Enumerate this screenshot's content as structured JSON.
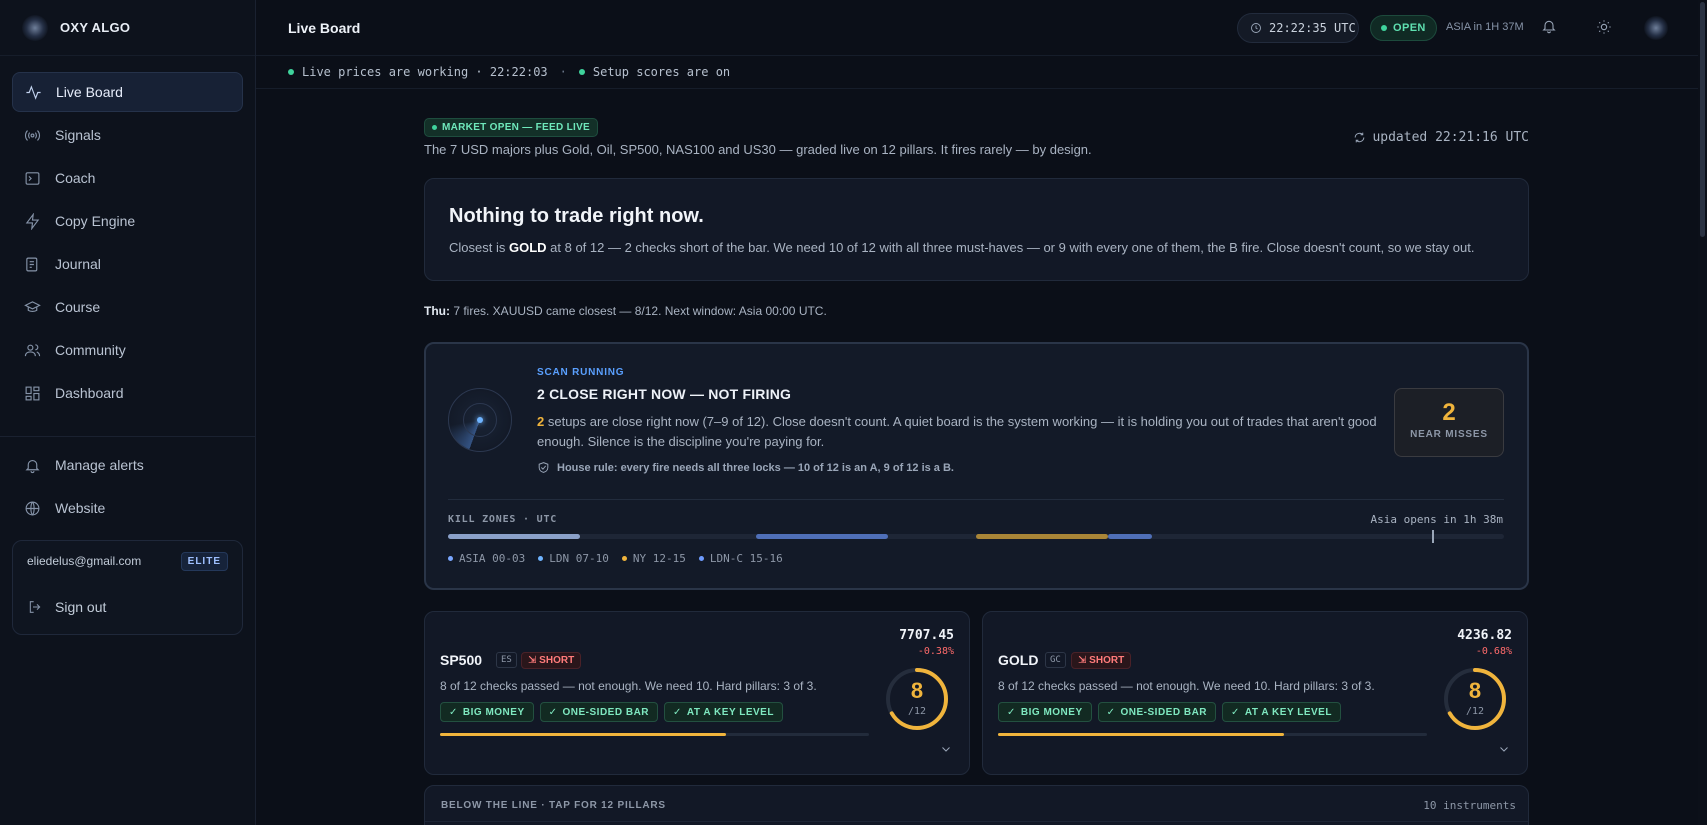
{
  "app": {
    "name": "OXY ALGO"
  },
  "sidebar": {
    "items": [
      {
        "label": "Live Board",
        "icon": "activity-icon"
      },
      {
        "label": "Signals",
        "icon": "broadcast-icon"
      },
      {
        "label": "Coach",
        "icon": "terminal-icon"
      },
      {
        "label": "Copy Engine",
        "icon": "lightning-icon"
      },
      {
        "label": "Journal",
        "icon": "journal-icon"
      },
      {
        "label": "Course",
        "icon": "graduation-cap-icon"
      },
      {
        "label": "Community",
        "icon": "users-icon"
      },
      {
        "label": "Dashboard",
        "icon": "grid-icon"
      }
    ],
    "secondary": [
      {
        "label": "Manage alerts",
        "icon": "bell-icon"
      },
      {
        "label": "Website",
        "icon": "globe-icon"
      }
    ],
    "user": {
      "email": "eliedelus@gmail.com",
      "tier": "ELITE",
      "signout": "Sign out"
    }
  },
  "header": {
    "title": "Live Board",
    "clock": "22:22:35 UTC",
    "market_status": "OPEN",
    "session_countdown": "ASIA in 1H 37M"
  },
  "status": {
    "prices": "Live prices are working · 22:22:03",
    "separator": "·",
    "scores": "Setup scores are on"
  },
  "main": {
    "market_pill": "MARKET OPEN — FEED LIVE",
    "intro": "The 7 USD majors plus Gold, Oil, SP500, NAS100 and US30 — graded live on 12 pillars. It fires rarely — by design.",
    "updated": "updated 22:21:16 UTC",
    "nothing_title": "Nothing to trade right now.",
    "nothing_pre": "Closest is ",
    "nothing_symbol": "GOLD",
    "nothing_post": " at 8 of 12 — 2 checks short of the bar. We need 10 of 12 with all three must-haves — or 9 with every one of them, the B fire. Close doesn't count, so we stay out.",
    "thu_label": "Thu:",
    "thu_text": " 7 fires. XAUUSD came closest — 8/12. Next window: Asia 00:00 UTC."
  },
  "scan": {
    "kicker": "SCAN RUNNING",
    "title": "2 CLOSE RIGHT NOW — NOT FIRING",
    "body_num": "2",
    "body_text": " setups are close right now (7–9 of 12). Close doesn't count. A quiet board is the system working — it is holding you out of trades that aren't good enough. Silence is the discipline you're paying for.",
    "house_rule": "House rule: every fire needs all three locks — 10 of 12 is an A, 9 of 12 is a B.",
    "near_misses_value": "2",
    "near_misses_label": "NEAR MISSES",
    "kill_zones_label": "KILL ZONES · UTC",
    "asia_opens": "Asia opens in 1h 38m",
    "now_hour_utc": 22.37,
    "zones": [
      {
        "name": "ASIA",
        "hours": "00-03",
        "start": 0,
        "end": 3,
        "color": "#8aa0c8"
      },
      {
        "name": "LDN",
        "hours": "07-10",
        "start": 7,
        "end": 10,
        "color": "#4f6fb8"
      },
      {
        "name": "NY",
        "hours": "12-15",
        "start": 12,
        "end": 15,
        "color": "#a98537"
      },
      {
        "name": "LDN-C",
        "hours": "15-16",
        "start": 15,
        "end": 16,
        "color": "#4f6fb8"
      }
    ],
    "legend_colors": [
      "#7aa7ff",
      "#6fb4ff",
      "#f0b43c",
      "#6f9cff"
    ]
  },
  "instruments": [
    {
      "symbol": "SP500",
      "code": "ES",
      "direction": "SHORT",
      "price": "7707.45",
      "change": "-0.38%",
      "desc": "8 of 12 checks passed — not enough. We need 10. Hard pillars: 3 of 3.",
      "tags": [
        "BIG MONEY",
        "ONE-SIDED BAR",
        "AT A KEY LEVEL"
      ],
      "score": "8",
      "score_of": "/12",
      "score_value": 8,
      "score_max": 12
    },
    {
      "symbol": "GOLD",
      "code": "GC",
      "direction": "SHORT",
      "price": "4236.82",
      "change": "-0.68%",
      "desc": "8 of 12 checks passed — not enough. We need 10. Hard pillars: 3 of 3.",
      "tags": [
        "BIG MONEY",
        "ONE-SIDED BAR",
        "AT A KEY LEVEL"
      ],
      "score": "8",
      "score_of": "/12",
      "score_value": 8,
      "score_max": 12
    }
  ],
  "below": {
    "label": "BELOW THE LINE · TAP FOR 12 PILLARS",
    "count": "10 instruments"
  },
  "colors": {
    "accent_gold": "#f0b43c",
    "accent_green": "#3fd39c",
    "accent_red": "#ff6b6b",
    "accent_blue": "#5aa0ff"
  }
}
